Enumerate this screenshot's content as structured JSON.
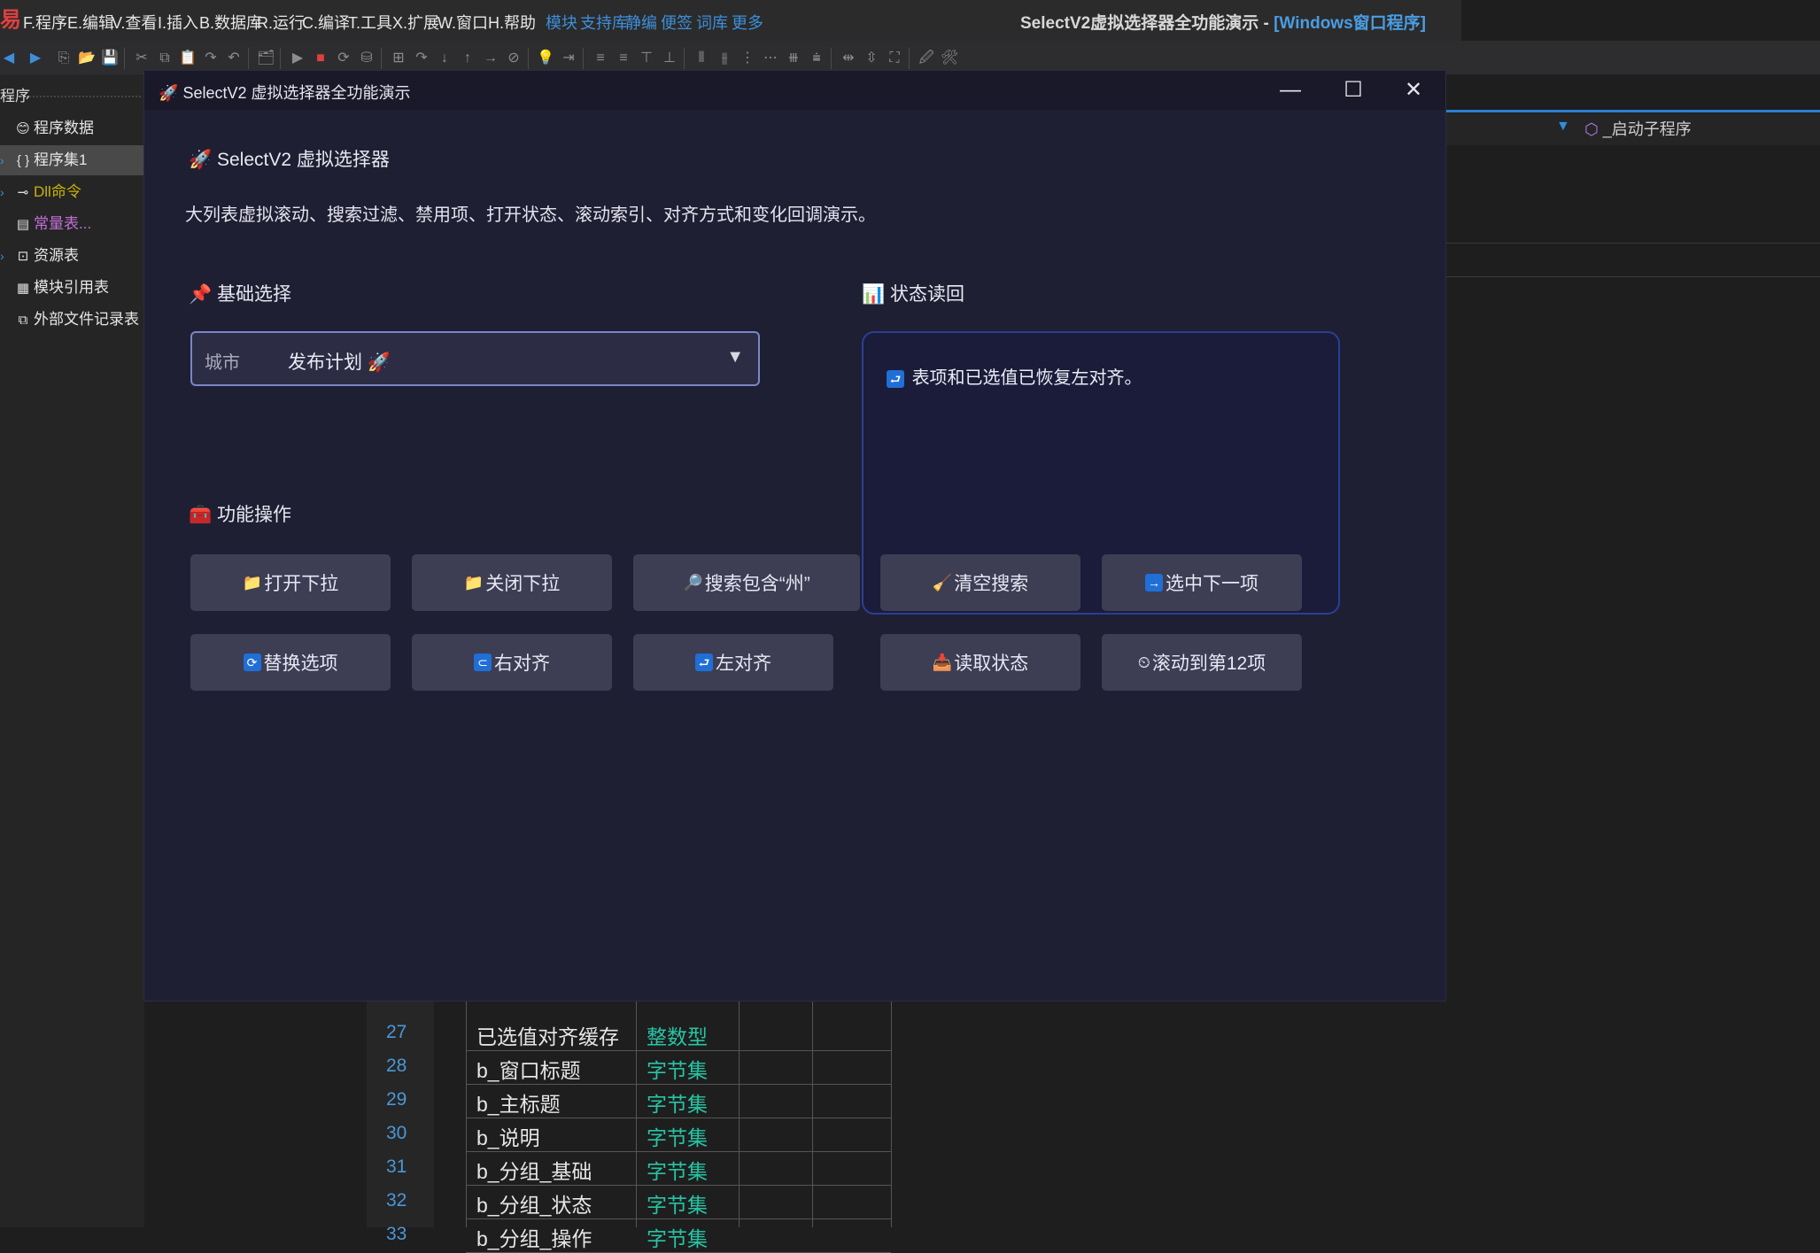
{
  "ide": {
    "menu": [
      {
        "label": "F.程序",
        "blue": false
      },
      {
        "label": "E.编辑",
        "blue": false
      },
      {
        "label": "V.查看",
        "blue": false
      },
      {
        "label": "I.插入",
        "blue": false
      },
      {
        "label": "B.数据库",
        "blue": false
      },
      {
        "label": "R.运行",
        "blue": false
      },
      {
        "label": "C.编译",
        "blue": false
      },
      {
        "label": "T.工具",
        "blue": false
      },
      {
        "label": "X.扩展",
        "blue": false
      },
      {
        "label": "W.窗口",
        "blue": false
      },
      {
        "label": "H.帮助",
        "blue": false
      },
      {
        "label": "模块",
        "blue": true
      },
      {
        "label": "支持库",
        "blue": true
      },
      {
        "label": "静编",
        "blue": true
      },
      {
        "label": "便签",
        "blue": true
      },
      {
        "label": "词库",
        "blue": true
      },
      {
        "label": "更多",
        "blue": true
      }
    ],
    "title_main": "SelectV2虚拟选择器全功能演示 - ",
    "title_suffix": "[Windows窗口程序]",
    "logo": "易",
    "tree": {
      "header": "程序",
      "items": [
        {
          "label": "程序数据",
          "icon": "😊",
          "color": "#e6e6e6",
          "arrow": ""
        },
        {
          "label": "程序集1",
          "icon": "{ }",
          "color": "#e6e6e6",
          "arrow": "›",
          "selected": true
        },
        {
          "label": "Dll命令",
          "icon": "⊸",
          "color": "#c8b400",
          "arrow": "›"
        },
        {
          "label": "常量表...",
          "icon": "▤",
          "color": "#c36fd6",
          "arrow": ""
        },
        {
          "label": "资源表",
          "icon": "⊡",
          "color": "#e6e6e6",
          "arrow": "›"
        },
        {
          "label": "模块引用表",
          "icon": "▦",
          "color": "#e6e6e6",
          "arrow": ""
        },
        {
          "label": "外部文件记录表",
          "icon": "⧉",
          "color": "#e6e6e6",
          "arrow": ""
        }
      ]
    },
    "sub_combo": "_启动子程序",
    "table_rows": [
      {
        "num": "27",
        "name": "已选值对齐缓存",
        "type": "整数型"
      },
      {
        "num": "28",
        "name": "b_窗口标题",
        "type": "字节集"
      },
      {
        "num": "29",
        "name": "b_主标题",
        "type": "字节集"
      },
      {
        "num": "30",
        "name": "b_说明",
        "type": "字节集"
      },
      {
        "num": "31",
        "name": "b_分组_基础",
        "type": "字节集"
      },
      {
        "num": "32",
        "name": "b_分组_状态",
        "type": "字节集"
      },
      {
        "num": "33",
        "name": "b_分组_操作",
        "type": "字节集"
      }
    ]
  },
  "window": {
    "title": "SelectV2 虚拟选择器全功能演示",
    "title_icon": "🚀",
    "min": "—",
    "max": "☐",
    "close": "✕"
  },
  "main": {
    "heading_icon": "🚀",
    "heading": "SelectV2 虚拟选择器",
    "description": "大列表虚拟滚动、搜索过滤、禁用项、打开状态、滚动索引、对齐方式和变化回调演示。",
    "basic": {
      "icon": "📌",
      "title": "基础选择"
    },
    "status": {
      "icon": "📊",
      "title": "状态读回"
    },
    "ops": {
      "icon": "🧰",
      "title": "功能操作"
    },
    "select": {
      "label": "城市",
      "value": "发布计划 🚀",
      "caret": "▼"
    },
    "status_text": "表项和已选值已恢复左对齐。",
    "status_icon": "⮐"
  },
  "buttons": {
    "row1": [
      {
        "icon": "📁",
        "label": "打开下拉",
        "boxed": false
      },
      {
        "icon": "📁",
        "label": "关闭下拉",
        "boxed": false
      },
      {
        "icon": "🔎",
        "label": "搜索包含“州”",
        "boxed": false
      },
      {
        "icon": "🧹",
        "label": "清空搜索",
        "boxed": false
      },
      {
        "icon": "→",
        "label": "选中下一项",
        "boxed": true
      }
    ],
    "row2": [
      {
        "icon": "⟳",
        "label": "替换选项",
        "boxed": true
      },
      {
        "icon": "⊂",
        "label": "右对齐",
        "boxed": true
      },
      {
        "icon": "⮐",
        "label": "左对齐",
        "boxed": true
      },
      {
        "icon": "📥",
        "label": "读取状态",
        "boxed": false
      },
      {
        "icon": "⏲",
        "label": "滚动到第12项",
        "boxed": false
      }
    ]
  }
}
